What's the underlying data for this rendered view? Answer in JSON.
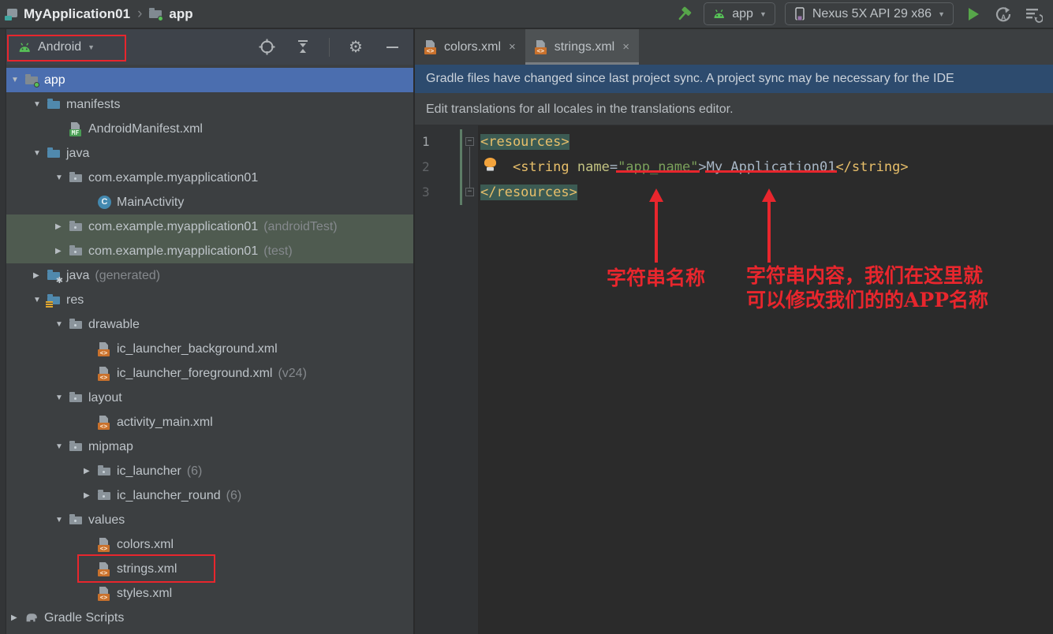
{
  "colors": {
    "annotation_red": "#e8262d",
    "selection_blue": "#4b6eaf",
    "test_row_green": "#4f5b50",
    "notification_blue": "#2d4b6e",
    "xml_badge_orange": "#c9712c",
    "android_green": "#57c257",
    "run_green": "#57a64a",
    "tag_yellow": "#e8bf6a",
    "string_green": "#7ba05b",
    "editor_background": "#2b2b2b"
  },
  "topbar": {
    "breadcrumb": {
      "project": "MyApplication01",
      "separator": "›",
      "module": "app"
    },
    "run_config": {
      "module": "app",
      "device": "Nexus 5X API 29 x86"
    }
  },
  "project_panel": {
    "view_selector": {
      "label": "Android"
    },
    "tree": [
      {
        "level": 0,
        "arrow": "open",
        "icon": "module-folder",
        "label": "app",
        "highlight": "selected"
      },
      {
        "level": 1,
        "arrow": "open",
        "icon": "folder-blue",
        "label": "manifests"
      },
      {
        "level": 2,
        "arrow": null,
        "icon": "manifest-file",
        "label": "AndroidManifest.xml"
      },
      {
        "level": 1,
        "arrow": "open",
        "icon": "folder-blue",
        "label": "java"
      },
      {
        "level": 2,
        "arrow": "open",
        "icon": "package-folder",
        "label": "com.example.myapplication01"
      },
      {
        "level": 3,
        "arrow": null,
        "icon": "class-circle",
        "label": "MainActivity"
      },
      {
        "level": 2,
        "arrow": "closed",
        "icon": "package-folder",
        "label": "com.example.myapplication01",
        "suffix": "(androidTest)",
        "highlight": "green"
      },
      {
        "level": 2,
        "arrow": "closed",
        "icon": "package-folder",
        "label": "com.example.myapplication01",
        "suffix": "(test)",
        "highlight": "green"
      },
      {
        "level": 1,
        "arrow": "closed",
        "icon": "generated-folder",
        "label": "java",
        "suffix": "(generated)"
      },
      {
        "level": 1,
        "arrow": "open",
        "icon": "res-folder",
        "label": "res"
      },
      {
        "level": 2,
        "arrow": "open",
        "icon": "folder-gray",
        "label": "drawable"
      },
      {
        "level": 3,
        "arrow": null,
        "icon": "xml-file",
        "label": "ic_launcher_background.xml"
      },
      {
        "level": 3,
        "arrow": null,
        "icon": "xml-file",
        "label": "ic_launcher_foreground.xml",
        "suffix": "(v24)"
      },
      {
        "level": 2,
        "arrow": "open",
        "icon": "folder-gray",
        "label": "layout"
      },
      {
        "level": 3,
        "arrow": null,
        "icon": "xml-file",
        "label": "activity_main.xml"
      },
      {
        "level": 2,
        "arrow": "open",
        "icon": "folder-gray",
        "label": "mipmap"
      },
      {
        "level": 3,
        "arrow": "closed",
        "icon": "folder-gray",
        "label": "ic_launcher",
        "suffix": "(6)"
      },
      {
        "level": 3,
        "arrow": "closed",
        "icon": "folder-gray",
        "label": "ic_launcher_round",
        "suffix": "(6)"
      },
      {
        "level": 2,
        "arrow": "open",
        "icon": "folder-gray",
        "label": "values"
      },
      {
        "level": 3,
        "arrow": null,
        "icon": "xml-file",
        "label": "colors.xml"
      },
      {
        "level": 3,
        "arrow": null,
        "icon": "xml-file",
        "label": "strings.xml",
        "redbox": true
      },
      {
        "level": 3,
        "arrow": null,
        "icon": "xml-file",
        "label": "styles.xml"
      },
      {
        "level": 0,
        "arrow": "closed",
        "icon": "gradle-elephant",
        "label": "Gradle Scripts"
      }
    ]
  },
  "editor": {
    "tabs": [
      {
        "label": "colors.xml",
        "active": false
      },
      {
        "label": "strings.xml",
        "active": true
      }
    ],
    "gradle_notification": "Gradle files have changed since last project sync. A project sync may be necessary for the IDE",
    "translations_notification": "Edit translations for all locales in the translations editor.",
    "code": {
      "lines": [
        {
          "num": "1",
          "tokens": [
            {
              "t": "<resources>",
              "c": "tag hl"
            }
          ]
        },
        {
          "num": "2",
          "bulb": true,
          "tokens": [
            {
              "t": "    ",
              "c": "plain"
            },
            {
              "t": "<string",
              "c": "tag"
            },
            {
              "t": " ",
              "c": "plain"
            },
            {
              "t": "name",
              "c": "attr"
            },
            {
              "t": "=",
              "c": "plain"
            },
            {
              "t": "\"app_name\"",
              "c": "value redline"
            },
            {
              "t": ">",
              "c": "plain"
            },
            {
              "t": "My Application01",
              "c": "text redline"
            },
            {
              "t": "</string>",
              "c": "tag"
            }
          ]
        },
        {
          "num": "3",
          "tokens": [
            {
              "t": "</resources>",
              "c": "tag hl"
            }
          ]
        }
      ]
    }
  },
  "annotations": {
    "string_name_label": "字符串名称",
    "string_content_label_line1": "字符串内容，我们在这里就",
    "string_content_label_line2": "可以修改我们的的APP名称"
  }
}
